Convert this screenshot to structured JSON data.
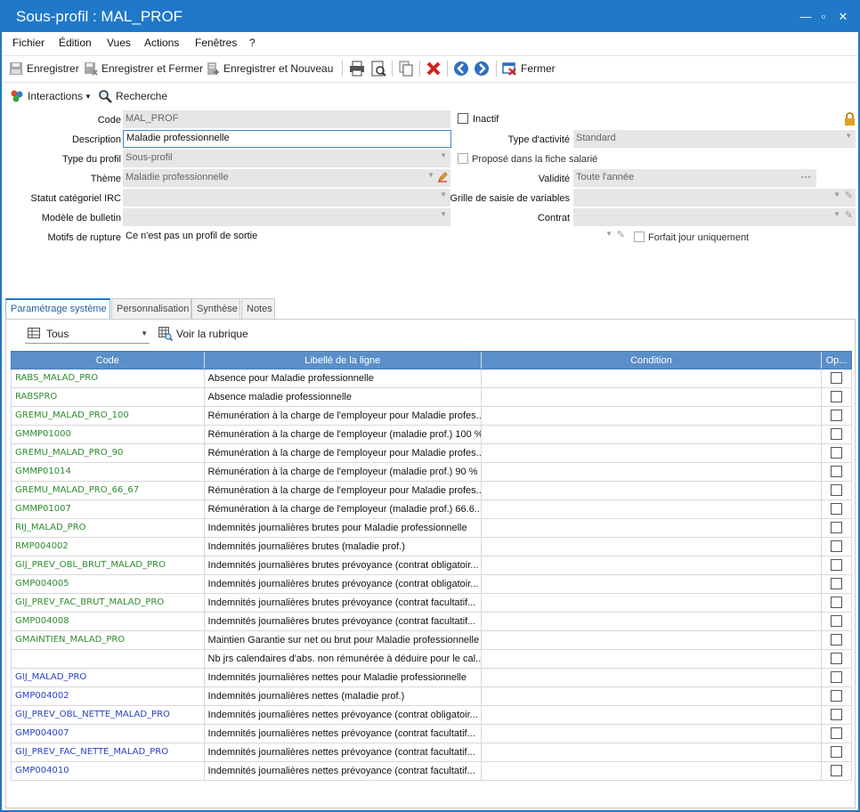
{
  "window": {
    "title": "Sous-profil : MAL_PROF",
    "controls": {
      "minimize": "—",
      "restore": "▫",
      "close": "✕"
    }
  },
  "menu": [
    "Fichier",
    "Édition",
    "Vues",
    "Actions",
    "Fenêtres",
    "?"
  ],
  "toolbar": {
    "save": "Enregistrer",
    "save_close": "Enregistrer et Fermer",
    "save_new": "Enregistrer et Nouveau",
    "close": "Fermer"
  },
  "toolbar2": {
    "interactions": "Interactions",
    "search": "Recherche"
  },
  "form": {
    "code": {
      "label": "Code",
      "value": "MAL_PROF"
    },
    "inactif": {
      "label": "Inactif"
    },
    "description": {
      "label": "Description",
      "value": "Maladie professionnelle"
    },
    "type_activite": {
      "label": "Type d'activité",
      "value": "Standard"
    },
    "type_profil": {
      "label": "Type du profil",
      "value": "Sous-profil"
    },
    "propose": {
      "label": "Proposé dans la fiche salarié"
    },
    "theme": {
      "label": "Thème",
      "value": "Maladie professionnelle"
    },
    "validite": {
      "label": "Validité",
      "value": "Toute l'année",
      "ellipsis": "···"
    },
    "statut": {
      "label": "Statut catégoriel IRC",
      "value": ""
    },
    "grille": {
      "label": "Grille de saisie de variables",
      "value": ""
    },
    "modele": {
      "label": "Modèle de bulletin",
      "value": ""
    },
    "contrat": {
      "label": "Contrat",
      "value": ""
    },
    "motifs": {
      "label": "Motifs de rupture",
      "value": "Ce n'est pas un profil de sortie"
    },
    "forfait": {
      "label": "Forfait jour uniquement"
    }
  },
  "tabs": [
    "Paramétrage système",
    "Personnalisation",
    "Synthèse",
    "Notes"
  ],
  "filter": {
    "value": "Tous",
    "voir_rubrique": "Voir la rubrique"
  },
  "grid": {
    "headers": [
      "Code",
      "Libellé de la ligne",
      "Condition",
      "Op..."
    ],
    "colors": {
      "green": "#2e8b2e",
      "blue": "#2a3fc4"
    },
    "rows": [
      {
        "code": "RABS_MALAD_PRO",
        "label": "Absence pour Maladie professionnelle",
        "color": "green"
      },
      {
        "code": "RABSPRO",
        "label": "Absence maladie professionnelle",
        "color": "green"
      },
      {
        "code": "GREMU_MALAD_PRO_100",
        "label": "Rémunération à la charge de l'employeur pour Maladie profes...",
        "color": "green"
      },
      {
        "code": "GMMP01000",
        "label": "Rémunération à la charge de l'employeur (maladie prof.) 100 %",
        "color": "green"
      },
      {
        "code": "GREMU_MALAD_PRO_90",
        "label": "Rémunération à la charge de l'employeur pour Maladie profes...",
        "color": "green"
      },
      {
        "code": "GMMP01014",
        "label": "Rémunération à la charge de l'employeur (maladie prof.) 90 %",
        "color": "green"
      },
      {
        "code": "GREMU_MALAD_PRO_66_67",
        "label": "Rémunération à la charge de l'employeur pour Maladie profes...",
        "color": "green"
      },
      {
        "code": "GMMP01007",
        "label": "Rémunération à la charge de l'employeur (maladie prof.) 66.6...",
        "color": "green"
      },
      {
        "code": "RIJ_MALAD_PRO",
        "label": "Indemnités journalières brutes pour Maladie professionnelle",
        "color": "green"
      },
      {
        "code": "RMP004002",
        "label": "Indemnités journalières brutes (maladie prof.)",
        "color": "green"
      },
      {
        "code": "GIJ_PREV_OBL_BRUT_MALAD_PRO",
        "label": "Indemnités journalières brutes prévoyance (contrat obligatoir...",
        "color": "green"
      },
      {
        "code": "GMP004005",
        "label": "Indemnités journalières brutes prévoyance (contrat obligatoir...",
        "color": "green"
      },
      {
        "code": "GIJ_PREV_FAC_BRUT_MALAD_PRO",
        "label": "Indemnités journalières brutes prévoyance (contrat facultatif...",
        "color": "green"
      },
      {
        "code": "GMP004008",
        "label": "Indemnités journalières brutes prévoyance (contrat facultatif...",
        "color": "green"
      },
      {
        "code": "GMAINTIEN_MALAD_PRO",
        "label": "Maintien Garantie sur net ou brut pour Maladie professionnelle",
        "color": "green"
      },
      {
        "code": "",
        "label": "Nb jrs calendaires d'abs. non rémunérée à déduire pour le cal...",
        "color": "green"
      },
      {
        "code": "GIJ_MALAD_PRO",
        "label": "Indemnités journalières nettes pour Maladie professionnelle",
        "color": "blue"
      },
      {
        "code": "GMP004002",
        "label": "Indemnités journalières nettes (maladie prof.)",
        "color": "blue"
      },
      {
        "code": "GIJ_PREV_OBL_NETTE_MALAD_PRO",
        "label": "Indemnités journalières nettes prévoyance (contrat obligatoir...",
        "color": "blue"
      },
      {
        "code": "GMP004007",
        "label": "Indemnités journalières nettes prévoyance (contrat facultatif...",
        "color": "blue"
      },
      {
        "code": "GIJ_PREV_FAC_NETTE_MALAD_PRO",
        "label": "Indemnités journalières nettes prévoyance (contrat facultatif...",
        "color": "blue"
      },
      {
        "code": "GMP004010",
        "label": "Indemnités journalières nettes prévoyance (contrat facultatif...",
        "color": "blue"
      }
    ]
  }
}
